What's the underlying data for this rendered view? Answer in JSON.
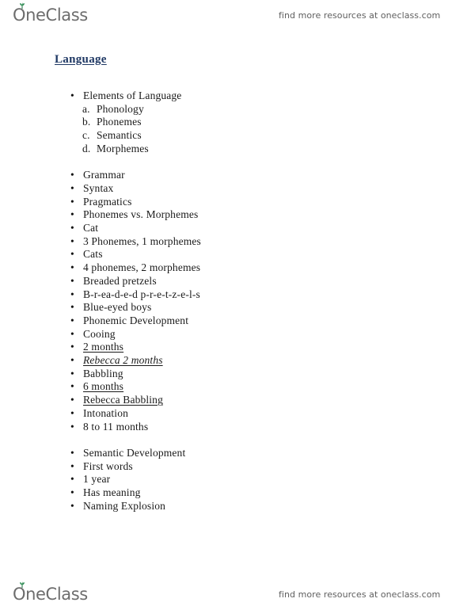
{
  "header": {
    "brand_name": "OneClass",
    "brand_icon": "sprout-icon",
    "resource_note": "find more resources at oneclass.com"
  },
  "footer": {
    "brand_name": "OneClass",
    "brand_icon": "sprout-icon",
    "resource_note": "find more resources at oneclass.com"
  },
  "document": {
    "title": "Language",
    "title_color": "#1f3864",
    "sections": [
      {
        "id": "elements",
        "bullets": [
          "Elements of Language"
        ],
        "sub_items": [
          {
            "marker": "a.",
            "label": "Phonology"
          },
          {
            "marker": "b.",
            "label": "Phonemes"
          },
          {
            "marker": "c.",
            "label": "Semantics"
          },
          {
            "marker": "d.",
            "label": "Morphemes"
          }
        ]
      },
      {
        "id": "grammar-and-phonemic-development",
        "items": [
          {
            "text": "Grammar",
            "style": "plain"
          },
          {
            "text": "Syntax",
            "style": "plain"
          },
          {
            "text": "Pragmatics",
            "style": "plain"
          },
          {
            "text": "Phonemes vs. Morphemes",
            "style": "plain"
          },
          {
            "text": "Cat",
            "style": "plain"
          },
          {
            "text": "3 Phonemes, 1 morphemes",
            "style": "plain"
          },
          {
            "text": "Cats",
            "style": "plain"
          },
          {
            "text": "4 phonemes, 2 morphemes",
            "style": "plain"
          },
          {
            "text": "Breaded pretzels",
            "style": "plain"
          },
          {
            "text": "B-r-ea-d-e-d p-r-e-t-z-e-l-s",
            "style": "plain"
          },
          {
            "text": "Blue-eyed boys",
            "style": "plain"
          },
          {
            "text": "Phonemic Development",
            "style": "plain"
          },
          {
            "text": "Cooing",
            "style": "plain"
          },
          {
            "text": "2 months",
            "style": "underline"
          },
          {
            "text": "Rebecca 2 months",
            "style": "underline-italic"
          },
          {
            "text": "Babbling",
            "style": "plain"
          },
          {
            "text": "6 months",
            "style": "underline"
          },
          {
            "text": "Rebecca Babbling",
            "style": "underline"
          },
          {
            "text": "Intonation",
            "style": "plain"
          },
          {
            "text": "8 to 11 months",
            "style": "plain"
          }
        ]
      },
      {
        "id": "semantic-development",
        "items": [
          {
            "text": "Semantic Development",
            "style": "plain"
          },
          {
            "text": "First words",
            "style": "plain"
          },
          {
            "text": "1 year",
            "style": "plain"
          },
          {
            "text": "Has meaning",
            "style": "plain"
          },
          {
            "text": "Naming Explosion",
            "style": "plain"
          }
        ]
      }
    ]
  }
}
